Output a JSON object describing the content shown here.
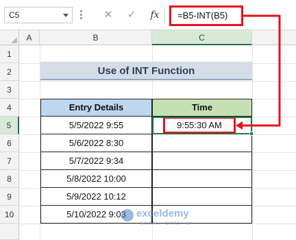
{
  "name_box": {
    "value": "C5"
  },
  "formula_bar": {
    "cancel_glyph": "✕",
    "enter_glyph": "✓",
    "fx_label": "fx",
    "formula": "=B5-INT(B5)"
  },
  "columns": [
    "A",
    "B",
    "C"
  ],
  "rows": [
    "1",
    "2",
    "3",
    "4",
    "5",
    "6",
    "7",
    "8",
    "9",
    "10"
  ],
  "sheet": {
    "title": "Use of INT Function",
    "headers": {
      "entry": "Entry Details",
      "time": "Time"
    },
    "entries": [
      "5/5/2022 9:55",
      "5/6/2022 8:30",
      "5/7/2022 9:34",
      "5/8/2022 10:00",
      "5/9/2022 10:12",
      "5/10/2022 9:03"
    ],
    "result": "9:55:30 AM"
  },
  "watermark": {
    "name": "exceldemy",
    "tagline": "EXCEL · DATA · BI"
  },
  "colors": {
    "highlight_red": "#e8101c",
    "excel_green": "#217346",
    "header_blue": "#bdd7ee",
    "header_green": "#c6e0b4",
    "title_bg": "#d6dce5"
  }
}
